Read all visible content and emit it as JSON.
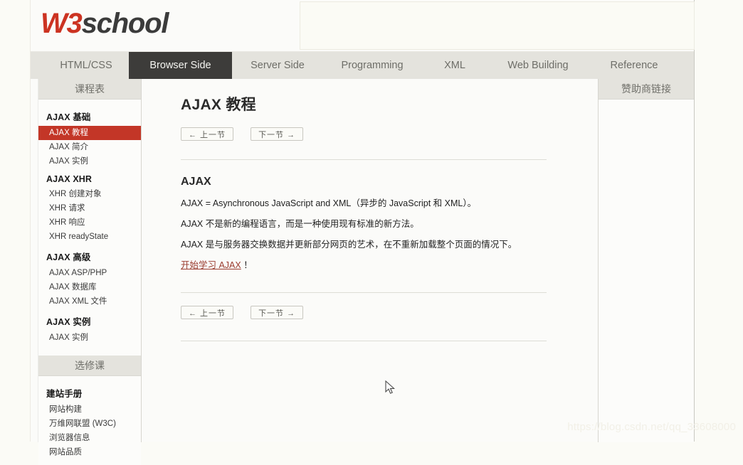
{
  "site": {
    "logo": {
      "part1": "W3",
      "part2": "school"
    },
    "banner_alt": "advertisement-placeholder"
  },
  "nav": {
    "tabs": [
      {
        "label": "HTML/CSS",
        "active": false
      },
      {
        "label": "Browser Side",
        "active": true
      },
      {
        "label": "Server Side",
        "active": false
      },
      {
        "label": "Programming",
        "active": false
      },
      {
        "label": "XML",
        "active": false
      },
      {
        "label": "Web Building",
        "active": false
      },
      {
        "label": "Reference",
        "active": false
      }
    ]
  },
  "sidebar": {
    "heading_courses": "课程表",
    "heading_electives": "选修课",
    "groups": [
      {
        "title": "AJAX 基础",
        "items": [
          {
            "label": "AJAX 教程",
            "active": true
          },
          {
            "label": "AJAX 简介",
            "active": false
          },
          {
            "label": "AJAX 实例",
            "active": false
          }
        ]
      },
      {
        "title": "AJAX XHR",
        "items": [
          {
            "label": "XHR 创建对象",
            "active": false
          },
          {
            "label": "XHR 请求",
            "active": false
          },
          {
            "label": "XHR 响应",
            "active": false
          },
          {
            "label": "XHR readyState",
            "active": false
          }
        ]
      },
      {
        "title": "AJAX 高级",
        "items": [
          {
            "label": "AJAX ASP/PHP",
            "active": false
          },
          {
            "label": "AJAX 数据库",
            "active": false
          },
          {
            "label": "AJAX XML 文件",
            "active": false
          }
        ]
      },
      {
        "title": "AJAX 实例",
        "items": [
          {
            "label": "AJAX 实例",
            "active": false
          }
        ]
      }
    ],
    "elective_groups": [
      {
        "title": "建站手册",
        "items": [
          {
            "label": "网站构建",
            "active": false
          },
          {
            "label": "万维网联盟 (W3C)",
            "active": false
          },
          {
            "label": "浏览器信息",
            "active": false
          },
          {
            "label": "网站品质",
            "active": false
          }
        ]
      }
    ]
  },
  "main": {
    "page_title": "AJAX 教程",
    "prev_button": "← 上一节",
    "next_button": "下一节 →",
    "section_heading": "AJAX",
    "paragraphs": [
      "AJAX = Asynchronous JavaScript and XML（异步的 JavaScript 和 XML）。",
      "AJAX 不是新的编程语言，而是一种使用现有标准的新方法。",
      "AJAX 是与服务器交换数据并更新部分网页的艺术，在不重新加载整个页面的情况下。"
    ],
    "cta_link": "开始学习 AJAX",
    "cta_suffix": "！"
  },
  "rightbar": {
    "heading": "赞助商链接"
  },
  "watermark": "https://blog.csdn.net/qq_33608000",
  "colors": {
    "accent_red": "#c33627",
    "logo_red": "#cc3322",
    "nav_bg": "#e4e3dd",
    "active_tab_bg": "#3d3c3a",
    "page_bg": "#fbfbf6",
    "link": "#9a3b2e"
  }
}
